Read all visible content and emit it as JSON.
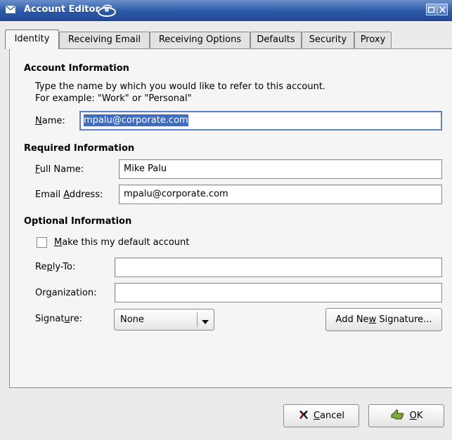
{
  "window": {
    "title": "Account Editor",
    "icons": {
      "app": "mail-envelope-icon",
      "swirl": "swirl-logo-icon",
      "maximize": "maximize-icon",
      "close": "close-icon"
    }
  },
  "tabs": [
    {
      "label": "Identity",
      "active": true
    },
    {
      "label": "Receiving Email",
      "active": false
    },
    {
      "label": "Receiving Options",
      "active": false
    },
    {
      "label": "Defaults",
      "active": false
    },
    {
      "label": "Security",
      "active": false
    },
    {
      "label": "Proxy",
      "active": false
    }
  ],
  "account_info": {
    "title": "Account Information",
    "description_line1": "Type the name by which you would like to refer to this account.",
    "description_line2": "For example: \"Work\" or \"Personal\"",
    "name_label_prefix": "N",
    "name_label_rest": "ame:",
    "name_value": "mpalu@corporate.com"
  },
  "required_info": {
    "title": "Required Information",
    "full_name_label_prefix": "F",
    "full_name_label_rest": "ull Name:",
    "full_name_value": "Mike Palu",
    "email_label_pre": "Email ",
    "email_label_u": "A",
    "email_label_post": "ddress:",
    "email_value": "mpalu@corporate.com"
  },
  "optional_info": {
    "title": "Optional Information",
    "default_checkbox_u": "M",
    "default_checkbox_rest": "ake this my default account",
    "default_checked": false,
    "reply_to_pre": "Re",
    "reply_to_u": "p",
    "reply_to_post": "ly-To:",
    "reply_to_value": "",
    "organization_pre": "Or",
    "organization_u": "g",
    "organization_post": "anization:",
    "organization_value": "",
    "signature_pre": "Signat",
    "signature_u": "u",
    "signature_post": "re:",
    "signature_value": "None",
    "add_signature_pre": "Add Ne",
    "add_signature_u": "w",
    "add_signature_post": " Signature..."
  },
  "footer": {
    "cancel_u": "C",
    "cancel_rest": "ancel",
    "ok_u": "O",
    "ok_rest": "K",
    "cancel_icon": "cancel-x-icon",
    "ok_icon": "ok-hand-icon"
  },
  "colors": {
    "titlebar": "#2c5aa8",
    "selection": "#3d6cc0",
    "focus_border": "#6183c4",
    "window_bg": "#ebebeb"
  }
}
